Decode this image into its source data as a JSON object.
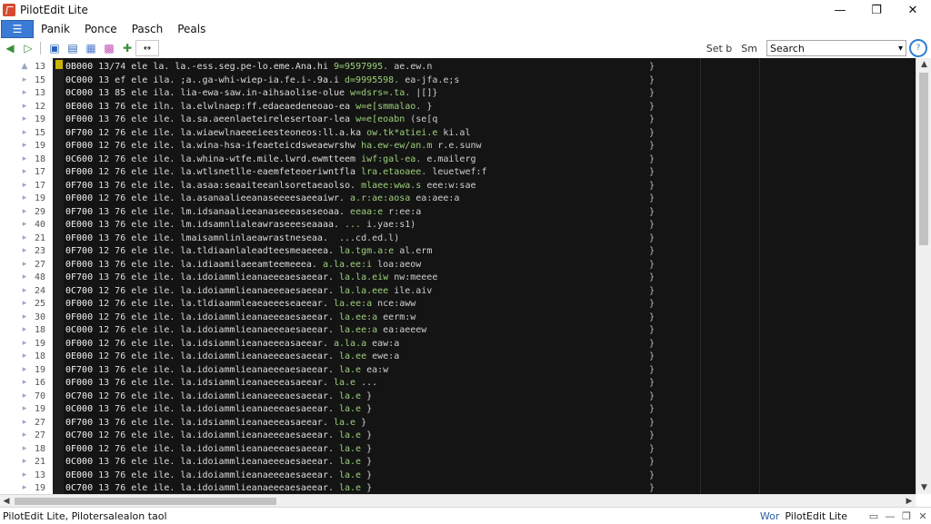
{
  "window": {
    "title": "PilotEdit Lite",
    "minimize": "—",
    "maximize": "❐",
    "close": "✕"
  },
  "menu": {
    "items": [
      "Panik",
      "Ponce",
      "Pasch",
      "Peals"
    ]
  },
  "toolbar": {
    "labels": [
      "Set b",
      "Sm"
    ],
    "search_value": "Search",
    "icons": [
      "back-icon",
      "forward-icon",
      "save-icon",
      "open-icon",
      "image-icon",
      "chart-icon",
      "pin-icon",
      "toggle-icon"
    ]
  },
  "gutter": {
    "line_numbers": [
      "13",
      "15",
      "13",
      "12",
      "19",
      "15",
      "19",
      "18",
      "17",
      "17",
      "19",
      "29",
      "40",
      "21",
      "23",
      "27",
      "48",
      "24",
      "25",
      "30",
      "18",
      "19",
      "18",
      "19",
      "16",
      "70",
      "19",
      "27",
      "27",
      "18",
      "21",
      "13",
      "19"
    ]
  },
  "code": {
    "rows": [
      {
        "offset": "0B000",
        "body": "13/74 ele la. la.-ess.seg.pe-lo.eme.Ana.hi",
        "hi": "9=9597995.",
        "tail": "ae.ew.n"
      },
      {
        "offset": "0C000",
        "body": "13 ef ele ila. ;a..ga-whi-wiep-ia.fe.i-.9a.i",
        "hi": "d=9995598.",
        "tail": "ea-jfa.e;s"
      },
      {
        "offset": "0C000",
        "body": "13 85 ele ila. lia-ewa-saw.in-aihsaolise-olue",
        "hi": "w=dsrs=.ta.",
        "tail": "|[]}"
      },
      {
        "offset": "0E000",
        "body": "13 76 ele iln. la.elwlnaep:ff.edaeaedeneoao-ea",
        "hi": "w=e[smmalao.",
        "tail": "}"
      },
      {
        "offset": "0F000",
        "body": "13 76 ele ile. la.sa.aeenlaeteirelesertoar-lea",
        "hi": "w=e[eoabn",
        "tail": "(se[q"
      },
      {
        "offset": "0F700",
        "body": "12 76 ele ile. la.wiaewlnaeeeieesteoneos:ll.a.ka",
        "hi": "ow.tk*atiei.e",
        "tail": "ki.al"
      },
      {
        "offset": "0F000",
        "body": "12 76 ele ile. la.wina-hsa-ifeaeteicdsweaewrshw",
        "hi": "ha.ew-ew/an.m",
        "tail": "r.e.sunw"
      },
      {
        "offset": "0C600",
        "body": "12 76 ele ile. la.whina-wtfe.mile.lwrd.ewmtteem",
        "hi": "iwf:gal-ea.",
        "tail": "e.mailerg"
      },
      {
        "offset": "0F000",
        "body": "12 76 ele ile. la.wtlsnetlle-eaemfeteoeriwntfla",
        "hi": "lra.etaoaee.",
        "tail": "leuetwef:f"
      },
      {
        "offset": "0F700",
        "body": "13 76 ele ile. la.asaa:seaaiteeanlsoretaeaolso.",
        "hi": "mlaee:wwa.s",
        "tail": "eee:w:sae"
      },
      {
        "offset": "0F000",
        "body": "12 76 ele ile. la.asanaalieeanaseeeesaeeaiwr.",
        "hi": "a.r:ae:aosa",
        "tail": "ea:aee:a"
      },
      {
        "offset": "0F700",
        "body": "13 76 ele ile. lm.idsanaalieeanaseeeaseseoaa.",
        "hi": "eeaa:e",
        "tail": "r:ee:a"
      },
      {
        "offset": "0E000",
        "body": "13 76 ele ile. lm.idsamnlialeawraseeeseaaaa.",
        "hi": "...",
        "tail": "i.yae:s1)"
      },
      {
        "offset": "0F000",
        "body": "13 76 ele ile. lmaisamnlinlaeawrastneseaa.",
        "hi": "",
        "tail": "...cd.ed.l)"
      },
      {
        "offset": "0F700",
        "body": "12 76 ele ile. la.tldiaanlaleadteesmeaeeea.",
        "hi": "la.tgm.a:e",
        "tail": "al.erm"
      },
      {
        "offset": "0F000",
        "body": "13 76 ele ile. la.idiaamilaeeamteemeeea.",
        "hi": "a.la.ee:i",
        "tail": "loa:aeow"
      },
      {
        "offset": "0F700",
        "body": "13 76 ele ile. la.idoiammlieanaeeeaesaeear.",
        "hi": "la.la.eiw",
        "tail": "nw:meeee"
      },
      {
        "offset": "0C700",
        "body": "12 76 ele ile. la.idoiammlieanaeeeaesaeear.",
        "hi": "la.la.eee",
        "tail": "ile.aiv"
      },
      {
        "offset": "0F000",
        "body": "12 76 ele ile. la.tldiaammleaeaeeeseaeear.",
        "hi": "la.ee:a",
        "tail": "nce:aww"
      },
      {
        "offset": "0F000",
        "body": "12 76 ele ile. la.idoiammlieanaeeeaesaeear.",
        "hi": "la.ee:a",
        "tail": "eerm:w"
      },
      {
        "offset": "0C000",
        "body": "12 76 ele ile. la.idoiammlieanaeeeaesaeear.",
        "hi": "la.ee:a",
        "tail": "ea:aeeew"
      },
      {
        "offset": "0F000",
        "body": "12 76 ele ile. la.idsiammlieanaeeeasaeear.",
        "hi": "a.la.a",
        "tail": "eaw:a"
      },
      {
        "offset": "0E000",
        "body": "12 76 ele ile. la.idoiammlieanaeeeaesaeear.",
        "hi": "la.ee",
        "tail": "ewe:a"
      },
      {
        "offset": "0F700",
        "body": "13 76 ele ile. la.idoiammlieanaeeeaesaeear.",
        "hi": "la.e",
        "tail": "ea:w"
      },
      {
        "offset": "0F000",
        "body": "13 76 ele ile. la.idsiammlieanaeeeasaeear.",
        "hi": "la.e",
        "tail": "..."
      },
      {
        "offset": "0C700",
        "body": "12 76 ele ile. la.idoiammlieanaeeeaesaeear.",
        "hi": "la.e",
        "tail": "}"
      },
      {
        "offset": "0C000",
        "body": "13 76 ele ile. la.idoiammlieanaeeeaesaeear.",
        "hi": "la.e",
        "tail": "}"
      },
      {
        "offset": "0F700",
        "body": "13 76 ele ile. la.idsiammlieanaeeeasaeear.",
        "hi": "la.e",
        "tail": "}"
      },
      {
        "offset": "0C700",
        "body": "12 76 ele ile. la.idoiammlieanaeeeaesaeear.",
        "hi": "la.e",
        "tail": "}"
      },
      {
        "offset": "0F000",
        "body": "12 76 ele ile. la.idoiammlieanaeeeaesaeear.",
        "hi": "la.e",
        "tail": "}"
      },
      {
        "offset": "0C000",
        "body": "13 76 ele ile. la.idoiammlieanaeeeaesaeear.",
        "hi": "la.e",
        "tail": "}"
      },
      {
        "offset": "0E000",
        "body": "13 76 ele ile. la.idoiammlieanaeeeaesaeear.",
        "hi": "la.e",
        "tail": "}"
      },
      {
        "offset": "0C700",
        "body": "13 76 ele ile. la.idoiammlieanaeeeaesaeear.",
        "hi": "la.e",
        "tail": "}"
      }
    ]
  },
  "status": {
    "left": "PilotEdit Lite, Pilotersalealon taol",
    "mode": "Wor",
    "app": "PilotEdit Lite"
  },
  "colors": {
    "editor_bg": "#141414",
    "accent": "#2f7fd1",
    "highlight": "#9ccf7a",
    "app_icon": "#d64a32"
  }
}
